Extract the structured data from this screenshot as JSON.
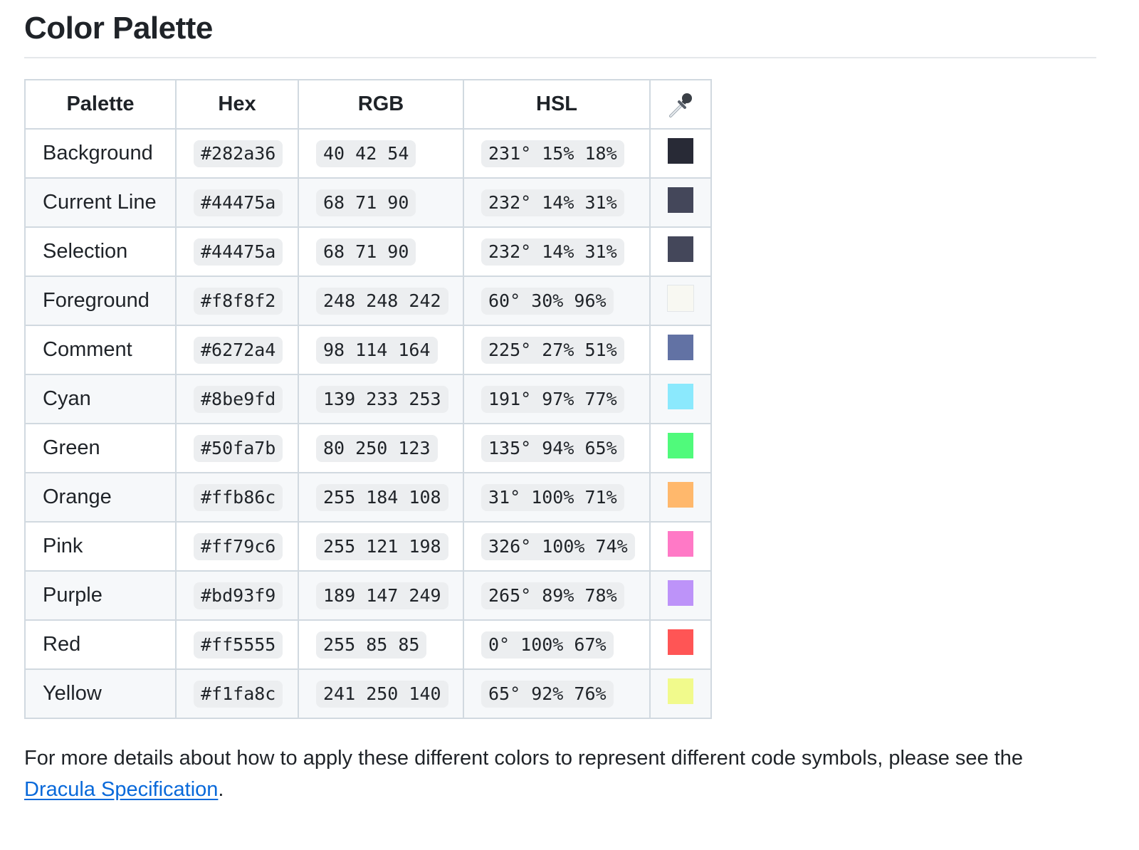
{
  "heading": "Color Palette",
  "table": {
    "headers": {
      "palette": "Palette",
      "hex": "Hex",
      "rgb": "RGB",
      "hsl": "HSL",
      "swatch_icon": "eyedropper-icon"
    },
    "rows": [
      {
        "name": "Background",
        "hex": "#282a36",
        "rgb": "40 42 54",
        "hsl": "231° 15% 18%",
        "color": "#282a36"
      },
      {
        "name": "Current Line",
        "hex": "#44475a",
        "rgb": "68 71 90",
        "hsl": "232° 14% 31%",
        "color": "#44475a"
      },
      {
        "name": "Selection",
        "hex": "#44475a",
        "rgb": "68 71 90",
        "hsl": "232° 14% 31%",
        "color": "#44475a"
      },
      {
        "name": "Foreground",
        "hex": "#f8f8f2",
        "rgb": "248 248 242",
        "hsl": "60° 30% 96%",
        "color": "#f8f8f2"
      },
      {
        "name": "Comment",
        "hex": "#6272a4",
        "rgb": "98 114 164",
        "hsl": "225° 27% 51%",
        "color": "#6272a4"
      },
      {
        "name": "Cyan",
        "hex": "#8be9fd",
        "rgb": "139 233 253",
        "hsl": "191° 97% 77%",
        "color": "#8be9fd"
      },
      {
        "name": "Green",
        "hex": "#50fa7b",
        "rgb": "80 250 123",
        "hsl": "135° 94% 65%",
        "color": "#50fa7b"
      },
      {
        "name": "Orange",
        "hex": "#ffb86c",
        "rgb": "255 184 108",
        "hsl": "31° 100% 71%",
        "color": "#ffb86c"
      },
      {
        "name": "Pink",
        "hex": "#ff79c6",
        "rgb": "255 121 198",
        "hsl": "326° 100% 74%",
        "color": "#ff79c6"
      },
      {
        "name": "Purple",
        "hex": "#bd93f9",
        "rgb": "189 147 249",
        "hsl": "265° 89% 78%",
        "color": "#bd93f9"
      },
      {
        "name": "Red",
        "hex": "#ff5555",
        "rgb": "255 85 85",
        "hsl": "0° 100% 67%",
        "color": "#ff5555"
      },
      {
        "name": "Yellow",
        "hex": "#f1fa8c",
        "rgb": "241 250 140",
        "hsl": "65° 92% 76%",
        "color": "#f1fa8c"
      }
    ]
  },
  "note": {
    "text": "For more details about how to apply these different colors to represent different code symbols, please see the",
    "link_label": "Dracula Specification",
    "suffix": "."
  },
  "colors": {
    "link": "#0969da",
    "border": "#d1d9e0",
    "row_alt": "#f6f8fa",
    "code_bg": "#eceef0"
  }
}
